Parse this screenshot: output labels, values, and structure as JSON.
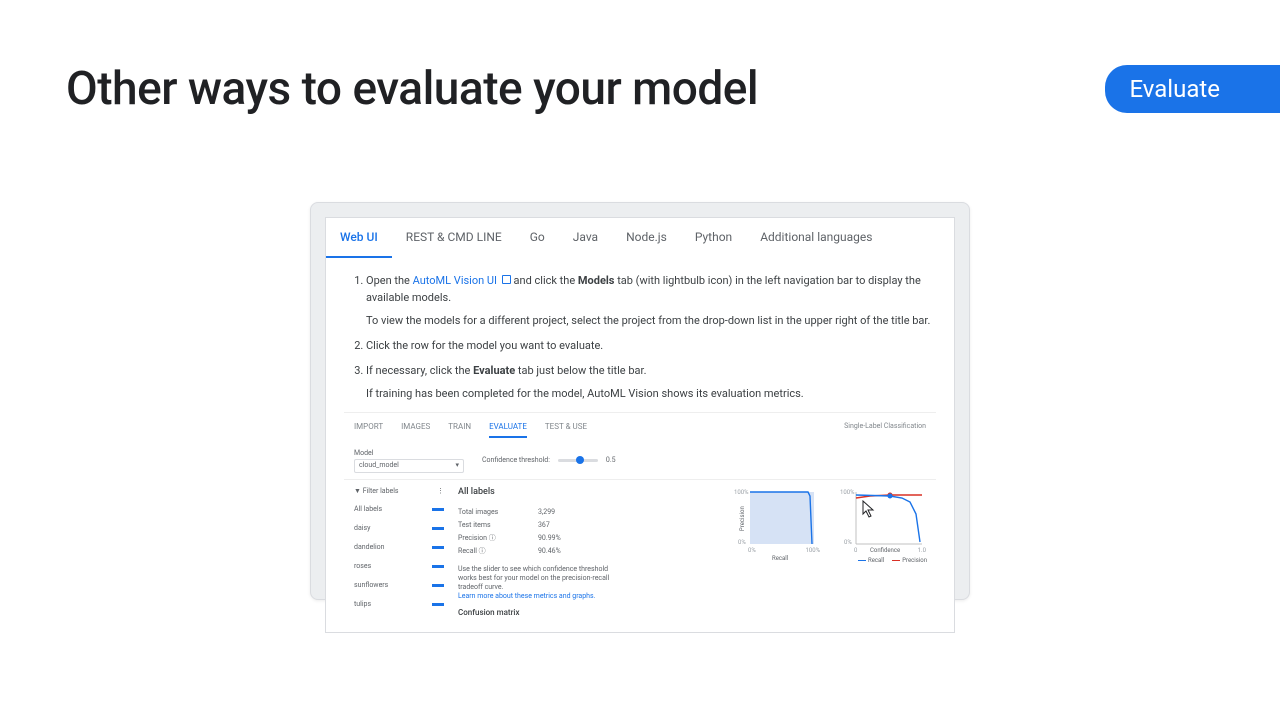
{
  "slide": {
    "title": "Other ways to evaluate your model",
    "stage": "Evaluate"
  },
  "doc_tabs": [
    "Web UI",
    "REST & CMD LINE",
    "Go",
    "Java",
    "Node.js",
    "Python",
    "Additional languages"
  ],
  "doc_tabs_active_index": 0,
  "steps": {
    "s1_a": "Open the ",
    "s1_link": "AutoML Vision UI",
    "s1_b": " and click the ",
    "s1_bold": "Models",
    "s1_c": " tab (with lightbulb icon) in the left navigation bar to display the available models.",
    "s1_sub": "To view the models for a different project, select the project from the drop-down list in the upper right of the title bar.",
    "s2": "Click the row for the model you want to evaluate.",
    "s3_a": "If necessary, click the ",
    "s3_bold": "Evaluate",
    "s3_b": " tab just below the title bar.",
    "s3_sub": "If training has been completed for the model, AutoML Vision shows its evaluation metrics."
  },
  "eval": {
    "tabs": [
      "IMPORT",
      "IMAGES",
      "TRAIN",
      "EVALUATE",
      "TEST & USE"
    ],
    "active_tab_index": 3,
    "model_field_label": "Model",
    "model_name": "cloud_model",
    "threshold_label": "Confidence threshold:",
    "threshold_value": "0.5",
    "classification_label": "Single-Label Classification",
    "filter_header": "Filter labels",
    "labels": [
      "All labels",
      "daisy",
      "dandelion",
      "roses",
      "sunflowers",
      "tulips"
    ],
    "section_title": "All labels",
    "metrics": [
      {
        "k": "Total images",
        "v": "3,299"
      },
      {
        "k": "Test items",
        "v": "367"
      },
      {
        "k": "Precision ⓘ",
        "v": "90.99%"
      },
      {
        "k": "Recall ⓘ",
        "v": "90.46%"
      }
    ],
    "hint_a": "Use the slider to see which confidence threshold works best for your model on the precision-recall tradeoff curve.",
    "hint_link": "Learn more about these metrics and graphs.",
    "confusion_title": "Confusion matrix",
    "graph1": {
      "y100": "100%",
      "y0": "0%",
      "x0": "0%",
      "x100": "100%",
      "ylabel": "Precision",
      "xlabel": "Recall"
    },
    "graph2": {
      "y100": "100%",
      "y0": "0%",
      "x0": "0",
      "x1": "1.0",
      "xlabel": "Confidence",
      "legend_a": "Recall",
      "legend_b": "Precision"
    }
  }
}
